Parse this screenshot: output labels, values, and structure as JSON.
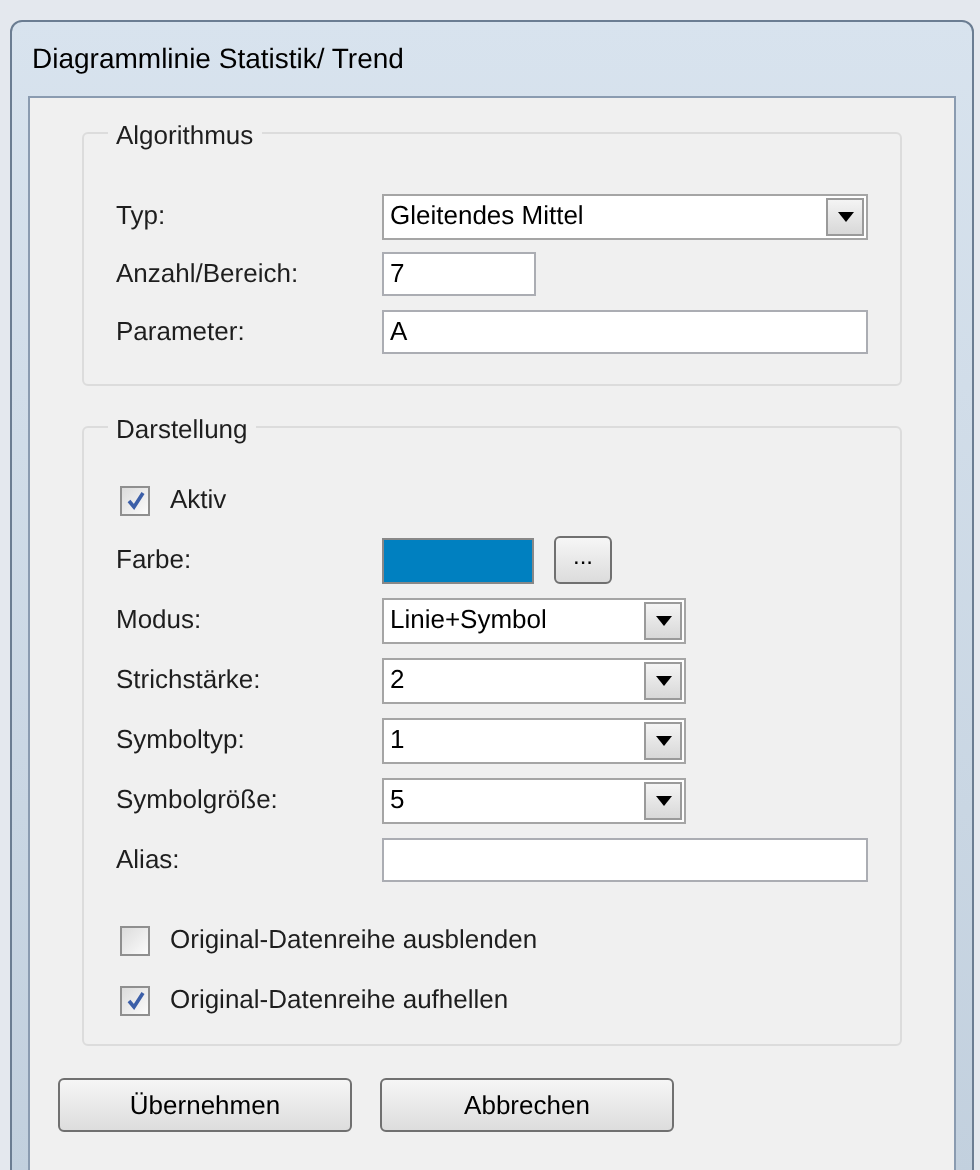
{
  "window": {
    "title": "Diagrammlinie Statistik/ Trend"
  },
  "groups": [
    {
      "title": "Algorithmus",
      "rows": [
        {
          "kind": "dropdown",
          "label": "Typ:",
          "value": "Gleitendes Mittel"
        },
        {
          "kind": "text",
          "label": "Anzahl/Bereich:",
          "value": "7"
        },
        {
          "kind": "text",
          "label": "Parameter:",
          "value": "A"
        }
      ]
    },
    {
      "title": "Darstellung",
      "rows": [
        {
          "kind": "checkbox",
          "label": "Aktiv",
          "checked": true
        },
        {
          "kind": "color",
          "label": "Farbe:",
          "color": "#0080c0",
          "button": "..."
        },
        {
          "kind": "dropdown",
          "label": "Modus:",
          "value": "Linie+Symbol"
        },
        {
          "kind": "dropdown",
          "label": "Strichstärke:",
          "value": "2"
        },
        {
          "kind": "dropdown",
          "label": "Symboltyp:",
          "value": "1"
        },
        {
          "kind": "dropdown",
          "label": "Symbolgröße:",
          "value": "5"
        },
        {
          "kind": "text",
          "label": "Alias:"
        },
        {
          "kind": "checkbox",
          "label": "Original-Datenreihe ausblenden",
          "checked": false
        },
        {
          "kind": "checkbox",
          "label": "Original-Datenreihe aufhellen",
          "checked": true
        }
      ]
    }
  ],
  "buttons": [
    "Übernehmen",
    "Abbrechen"
  ]
}
